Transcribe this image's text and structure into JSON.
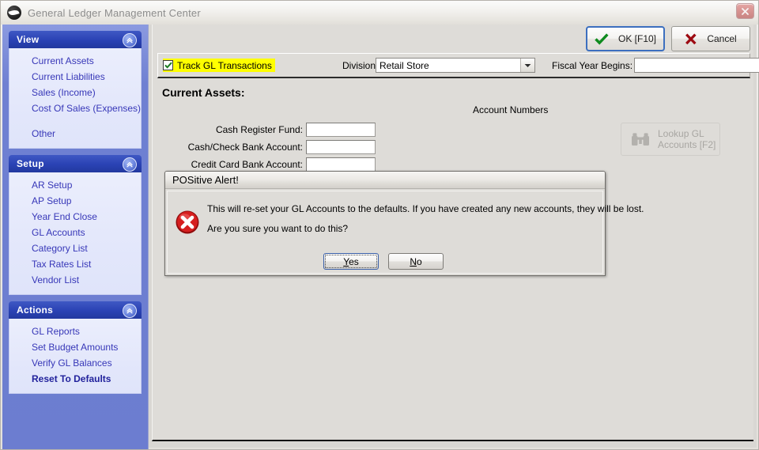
{
  "window": {
    "title": "General Ledger Management Center",
    "icon": "app-swoosh-icon",
    "close_label": "×"
  },
  "sidebar": {
    "groups": [
      {
        "title": "View",
        "collapse_icon": "double-chevron-up-icon",
        "items": [
          {
            "label": "Current Assets",
            "bold": false
          },
          {
            "label": "Current Liabilities",
            "bold": false
          },
          {
            "label": "Sales (Income)",
            "bold": false
          },
          {
            "label": "Cost Of Sales (Expenses)",
            "bold": false
          },
          {
            "label": "Other",
            "bold": false,
            "spaced": true
          }
        ]
      },
      {
        "title": "Setup",
        "collapse_icon": "double-chevron-up-icon",
        "items": [
          {
            "label": "AR Setup",
            "bold": false
          },
          {
            "label": "AP Setup",
            "bold": false
          },
          {
            "label": "Year End Close",
            "bold": false
          },
          {
            "label": "GL Accounts",
            "bold": false
          },
          {
            "label": "Category List",
            "bold": false
          },
          {
            "label": "Tax Rates List",
            "bold": false
          },
          {
            "label": "Vendor List",
            "bold": false
          }
        ]
      },
      {
        "title": "Actions",
        "collapse_icon": "double-chevron-up-icon",
        "items": [
          {
            "label": "GL Reports",
            "bold": false
          },
          {
            "label": "Set Budget Amounts",
            "bold": false
          },
          {
            "label": "Verify GL Balances",
            "bold": false
          },
          {
            "label": "Reset To Defaults",
            "bold": true
          }
        ]
      }
    ]
  },
  "command_bar": {
    "ok_label": "OK [F10]",
    "ok_icon": "green-check-icon",
    "cancel_label": "Cancel",
    "cancel_icon": "red-x-icon"
  },
  "options": {
    "track_gl_label": "Track GL Transactions",
    "track_gl_checked": true,
    "track_gl_highlight": "#ffff00",
    "division_label": "Division:",
    "division_value": "Retail Store",
    "fiscal_label": "Fiscal Year Begins:",
    "fiscal_value": "",
    "dropdown_icon": "chevron-down-icon"
  },
  "form": {
    "section_title": "Current Assets:",
    "column_header": "Account Numbers",
    "rows": [
      {
        "label": "Cash Register Fund:",
        "value": ""
      },
      {
        "label": "Cash/Check Bank Account:",
        "value": ""
      },
      {
        "label": "Credit Card Bank Account:",
        "value": ""
      }
    ],
    "lookup_label": "Lookup GL\nAccounts [F2]",
    "lookup_icon": "binoculars-icon",
    "lookup_enabled": false
  },
  "alert": {
    "title": "POSitive Alert!",
    "icon": "red-error-x-icon",
    "line1": "This will re-set your GL Accounts to the defaults.  If you have created any new accounts, they will be lost.",
    "line2": "Are you sure you want to do this?",
    "yes_mnemonic": "Y",
    "yes_rest": "es",
    "no_mnemonic": "N",
    "no_rest": "o"
  },
  "colors": {
    "sidebar_blue": "#6c7dd0",
    "nav_header_blue": "#2a42b4",
    "nav_link": "#3737b8",
    "highlight_yellow": "#ffff00",
    "face": "#dedcd8",
    "error_red": "#c50f0f",
    "ok_focus_blue": "#3c6fbf"
  }
}
